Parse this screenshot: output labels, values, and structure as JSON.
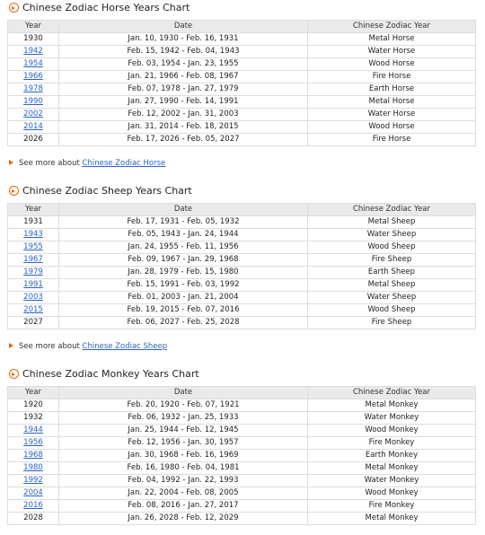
{
  "sections": [
    {
      "title": "Chinese Zodiac Horse Years Chart",
      "headers": [
        "Year",
        "Date",
        "Chinese Zodiac Year"
      ],
      "rows": [
        {
          "year": "1930",
          "date": "Jan. 10, 1930 - Feb. 16, 1931",
          "zodiac": "Metal Horse",
          "link": false
        },
        {
          "year": "1942",
          "date": "Feb. 15, 1942 - Feb. 04, 1943",
          "zodiac": "Water Horse",
          "link": true
        },
        {
          "year": "1954",
          "date": "Feb. 03, 1954 - Jan. 23, 1955",
          "zodiac": "Wood Horse",
          "link": true
        },
        {
          "year": "1966",
          "date": "Jan. 21, 1966 - Feb. 08, 1967",
          "zodiac": "Fire Horse",
          "link": true
        },
        {
          "year": "1978",
          "date": "Feb. 07, 1978 - Jan. 27, 1979",
          "zodiac": "Earth Horse",
          "link": true
        },
        {
          "year": "1990",
          "date": "Jan. 27, 1990 - Feb. 14, 1991",
          "zodiac": "Metal Horse",
          "link": true
        },
        {
          "year": "2002",
          "date": "Feb. 12, 2002 - Jan. 31, 2003",
          "zodiac": "Water Horse",
          "link": true
        },
        {
          "year": "2014",
          "date": "Jan. 31, 2014 - Feb. 18, 2015",
          "zodiac": "Wood Horse",
          "link": true
        },
        {
          "year": "2026",
          "date": "Feb. 17, 2026 - Feb. 05, 2027",
          "zodiac": "Fire Horse",
          "link": false
        }
      ],
      "more_text": "See more about",
      "more_link": "Chinese Zodiac Horse"
    },
    {
      "title": "Chinese Zodiac Sheep Years Chart",
      "headers": [
        "Year",
        "Date",
        "Chinese Zodiac Year"
      ],
      "rows": [
        {
          "year": "1931",
          "date": "Feb. 17, 1931 - Feb. 05, 1932",
          "zodiac": "Metal Sheep",
          "link": false
        },
        {
          "year": "1943",
          "date": "Feb. 05, 1943 - Jan. 24, 1944",
          "zodiac": "Water Sheep",
          "link": true
        },
        {
          "year": "1955",
          "date": "Jan. 24, 1955 - Feb. 11, 1956",
          "zodiac": "Wood Sheep",
          "link": true
        },
        {
          "year": "1967",
          "date": "Feb. 09, 1967 - Jan. 29, 1968",
          "zodiac": "Fire Sheep",
          "link": true
        },
        {
          "year": "1979",
          "date": "Jan. 28, 1979 - Feb. 15, 1980",
          "zodiac": "Earth Sheep",
          "link": true
        },
        {
          "year": "1991",
          "date": "Feb. 15, 1991 - Feb. 03, 1992",
          "zodiac": "Metal Sheep",
          "link": true
        },
        {
          "year": "2003",
          "date": "Feb. 01, 2003 - Jan. 21, 2004",
          "zodiac": "Water Sheep",
          "link": true
        },
        {
          "year": "2015",
          "date": "Feb. 19, 2015 - Feb. 07, 2016",
          "zodiac": "Wood Sheep",
          "link": true
        },
        {
          "year": "2027",
          "date": "Feb. 06, 2027 - Feb. 25, 2028",
          "zodiac": "Fire Sheep",
          "link": false
        }
      ],
      "more_text": "See more about",
      "more_link": "Chinese Zodiac Sheep"
    },
    {
      "title": "Chinese Zodiac Monkey Years Chart",
      "headers": [
        "Year",
        "Date",
        "Chinese Zodiac Year"
      ],
      "rows": [
        {
          "year": "1920",
          "date": "Feb. 20, 1920 - Feb. 07, 1921",
          "zodiac": "Metal Monkey",
          "link": false
        },
        {
          "year": "1932",
          "date": "Feb. 06, 1932 - Jan. 25, 1933",
          "zodiac": "Water Monkey",
          "link": false
        },
        {
          "year": "1944",
          "date": "Jan. 25, 1944 - Feb. 12, 1945",
          "zodiac": "Wood Monkey",
          "link": true
        },
        {
          "year": "1956",
          "date": "Feb. 12, 1956 - Jan. 30, 1957",
          "zodiac": "Fire Monkey",
          "link": true
        },
        {
          "year": "1968",
          "date": "Jan. 30, 1968 - Feb. 16, 1969",
          "zodiac": "Earth Monkey",
          "link": true
        },
        {
          "year": "1980",
          "date": "Feb. 16, 1980 - Feb. 04, 1981",
          "zodiac": "Metal Monkey",
          "link": true
        },
        {
          "year": "1992",
          "date": "Feb. 04, 1992 - Jan. 22, 1993",
          "zodiac": "Water Monkey",
          "link": true
        },
        {
          "year": "2004",
          "date": "Jan. 22, 2004 - Feb. 08, 2005",
          "zodiac": "Wood Monkey",
          "link": true
        },
        {
          "year": "2016",
          "date": "Feb. 08, 2016 - Jan. 27, 2017",
          "zodiac": "Fire Monkey",
          "link": true
        },
        {
          "year": "2028",
          "date": "Jan. 26, 2028 - Feb. 12, 2029",
          "zodiac": "Metal Monkey",
          "link": false
        }
      ]
    }
  ],
  "colors": {
    "accent": "#e26b0a",
    "link": "#2a63c9",
    "header_bg": "#eaeaea",
    "border": "#dddddd"
  },
  "icons": {
    "section_header": "orange-circle-arrow-icon",
    "see_more": "orange-triangle-arrow-icon"
  }
}
